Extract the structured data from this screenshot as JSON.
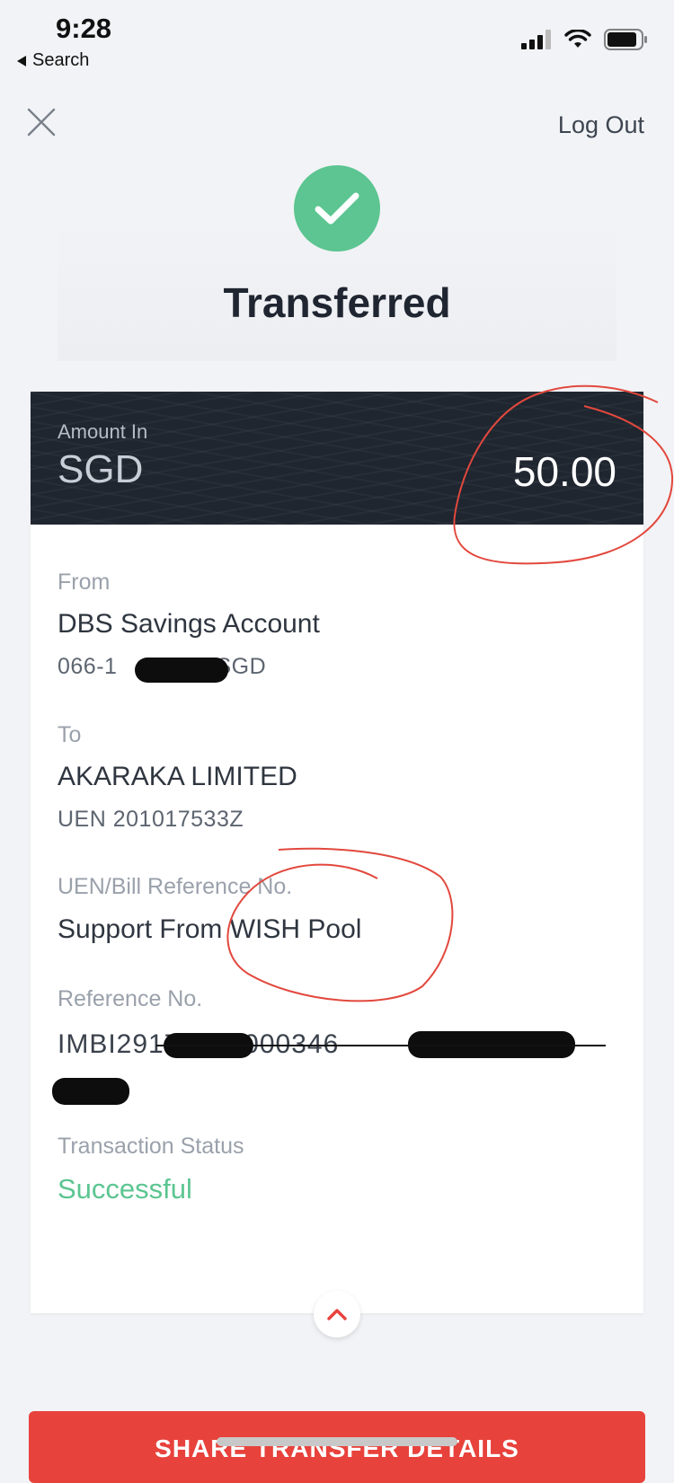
{
  "status_bar": {
    "time": "9:28",
    "back_label": "Search"
  },
  "nav": {
    "logout_label": "Log Out"
  },
  "header": {
    "title": "Transferred"
  },
  "amount": {
    "label": "Amount In",
    "currency": "SGD",
    "value": "50.00"
  },
  "from": {
    "label": "From",
    "account_name": "DBS Savings Account",
    "account_prefix": "066-1",
    "account_currency": "SGD"
  },
  "to": {
    "label": "To",
    "name": "AKARAKA LIMITED",
    "uen": "UEN 201017533Z"
  },
  "bill_ref": {
    "label": "UEN/Bill Reference No.",
    "value": "Support From WISH Pool"
  },
  "reference": {
    "label": "Reference No.",
    "value_visible": "IMBI29178370000346"
  },
  "transaction_status": {
    "label": "Transaction Status",
    "value": "Successful"
  },
  "actions": {
    "share_label": "SHARE TRANSFER DETAILS"
  },
  "colors": {
    "success": "#5cc591",
    "banner": "#1f2630",
    "share_button": "#e8423c",
    "annotation": "#e2483d"
  },
  "icons": [
    "back-triangle-icon",
    "signal-icon",
    "wifi-icon",
    "battery-icon",
    "close-icon",
    "checkmark-icon",
    "chevron-up-icon"
  ]
}
